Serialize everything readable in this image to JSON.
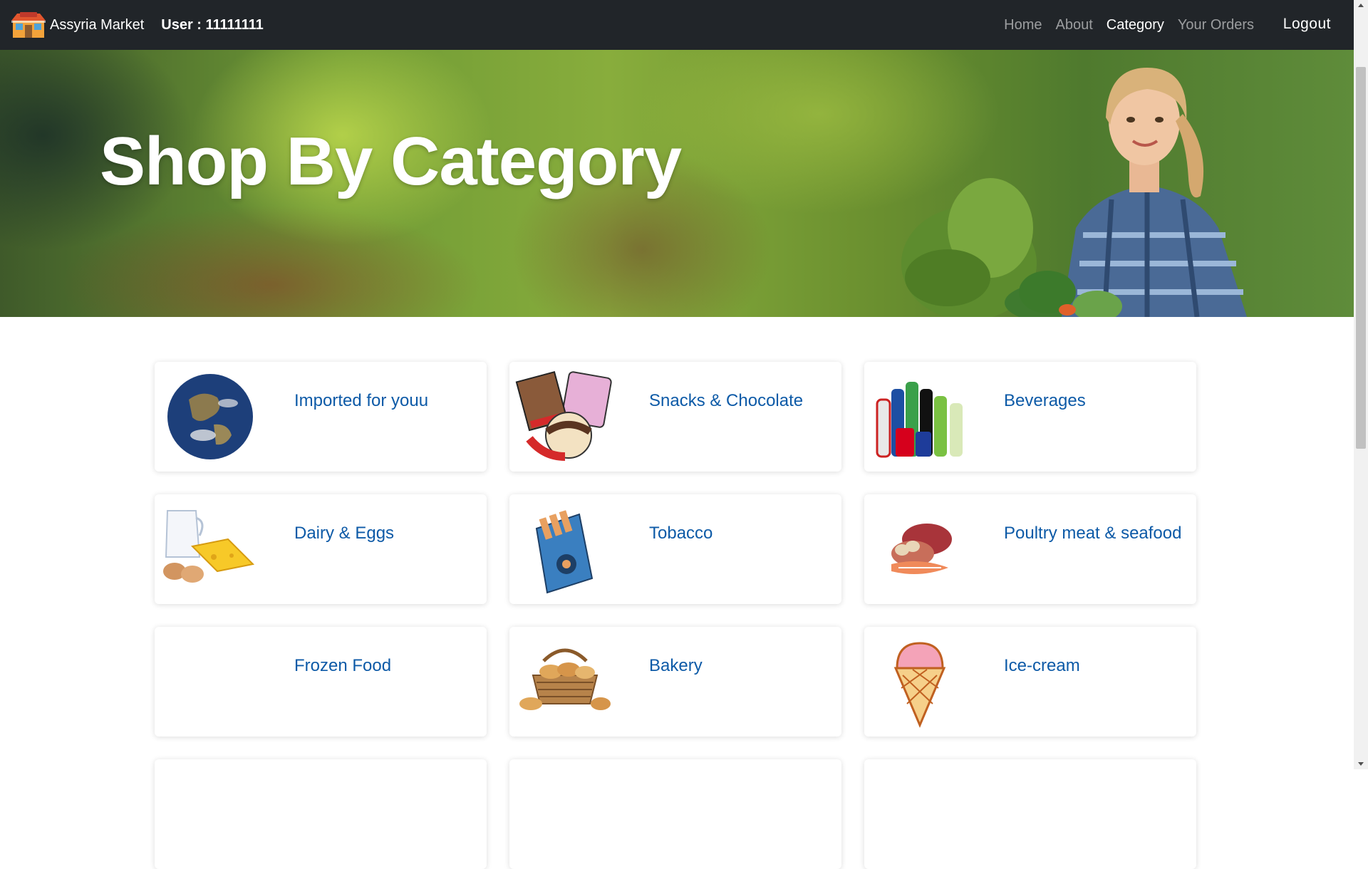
{
  "navbar": {
    "brand_name": "Assyria Market",
    "user_label": "User : 11111111",
    "links": [
      {
        "label": "Home"
      },
      {
        "label": "About"
      },
      {
        "label": "Category",
        "active": true
      },
      {
        "label": "Your Orders"
      }
    ],
    "logout_label": "Logout",
    "background_color": "#212529"
  },
  "hero": {
    "title": "Shop By Category"
  },
  "categories": [
    {
      "title": "Imported for youu",
      "icon": "earth-globe-icon"
    },
    {
      "title": "Snacks & Chocolate",
      "icon": "chocolate-sweets-icon"
    },
    {
      "title": "Beverages",
      "icon": "beverage-bottles-icon"
    },
    {
      "title": "Dairy & Eggs",
      "icon": "milk-cheese-eggs-icon"
    },
    {
      "title": "Tobacco",
      "icon": "cigarette-pack-icon"
    },
    {
      "title": "Poultry meat & seafood",
      "icon": "meat-seafood-icon"
    },
    {
      "title": "Frozen Food",
      "icon": ""
    },
    {
      "title": "Bakery",
      "icon": "bread-basket-icon"
    },
    {
      "title": "Ice-cream",
      "icon": "ice-cream-cone-icon"
    }
  ],
  "colors": {
    "category_title": "#0d5aa7",
    "card_background": "#ffffff"
  }
}
